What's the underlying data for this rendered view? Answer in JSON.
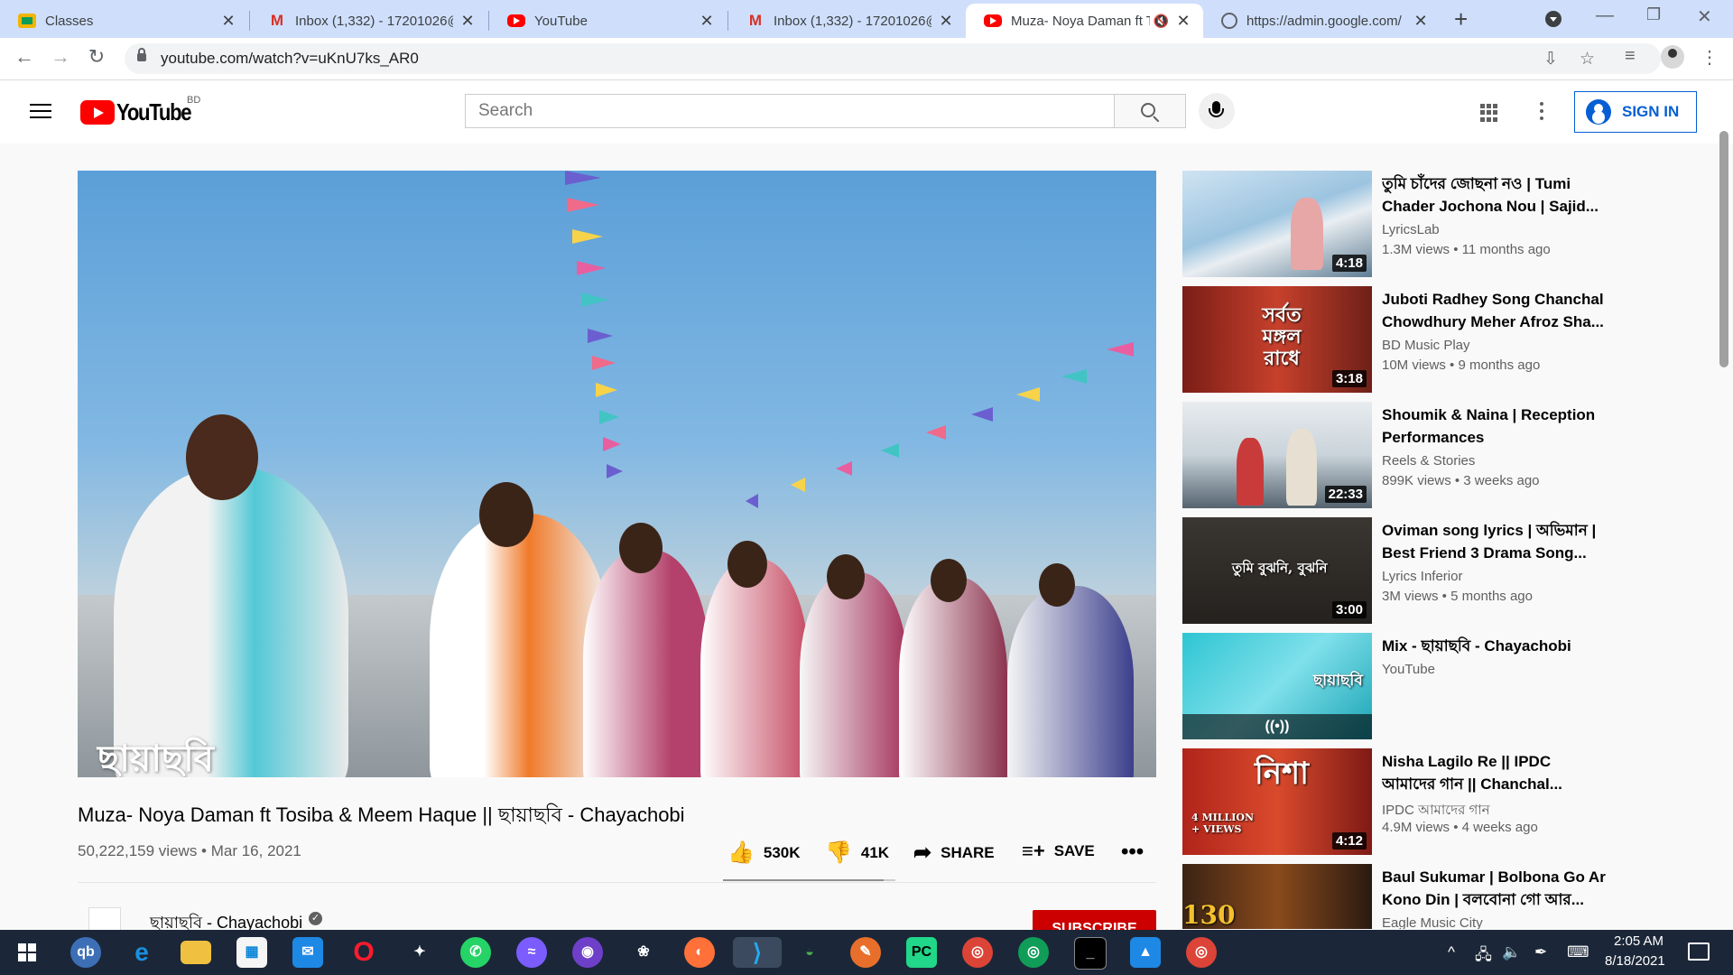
{
  "browser": {
    "tabs": [
      {
        "title": "Classes",
        "favicon": "classroom-icon"
      },
      {
        "title": "Inbox (1,332) - 17201026@",
        "favicon": "gmail-icon"
      },
      {
        "title": "YouTube",
        "favicon": "youtube-icon"
      },
      {
        "title": "Inbox (1,332) - 17201026@",
        "favicon": "gmail-icon"
      },
      {
        "title": "Muza- Noya Daman ft T",
        "favicon": "youtube-icon",
        "active": true
      },
      {
        "title": "https://admin.google.com/",
        "favicon": "globe-icon"
      }
    ],
    "url": "youtube.com/watch?v=uKnU7ks_AR0"
  },
  "youtube": {
    "logo_text": "YouTube",
    "country": "BD",
    "search_placeholder": "Search",
    "sign_in_label": "SIGN IN"
  },
  "video": {
    "watermark": "ছায়াছবি",
    "title": "Muza- Noya Daman ft Tosiba & Meem Haque || ছায়াছবি - Chayachobi",
    "views_date": "50,222,159 views • Mar 16, 2021",
    "likes": "530K",
    "dislikes": "41K",
    "share_label": "SHARE",
    "save_label": "SAVE",
    "like_ratio": 0.93,
    "channel_name": "ছায়াছবি - Chayachobi",
    "subscribe_label": "SUBSCRIBE"
  },
  "recommendations": [
    {
      "title": "তুমি চাঁদের জোছনা নও | Tumi Chader Jochona Nou | Sajid...",
      "channel": "LyricsLab",
      "meta": "1.3M views • 11 months ago",
      "duration": "4:18"
    },
    {
      "title": "Juboti Radhey Song Chanchal Chowdhury Meher Afroz Sha...",
      "channel": "BD Music Play",
      "meta": "10M views • 9 months ago",
      "duration": "3:18",
      "thumb_text": "সর্বত মঙ্গল রাধে"
    },
    {
      "title": "Shoumik & Naina | Reception Performances",
      "channel": "Reels & Stories",
      "meta": "899K views • 3 weeks ago",
      "duration": "22:33"
    },
    {
      "title": "Oviman song lyrics | অভিমান | Best Friend 3 Drama Song...",
      "channel": "Lyrics Inferior",
      "meta": "3M views • 5 months ago",
      "duration": "3:00",
      "thumb_text": "তুমি বুঝনি, বুঝনি"
    },
    {
      "title": "Mix - ছায়াছবি - Chayachobi",
      "channel": "YouTube",
      "meta": "",
      "duration": "((•))",
      "thumb_text": "ছায়াছবি"
    },
    {
      "title": "Nisha Lagilo Re || IPDC আমাদের গান || Chanchal...",
      "channel": "IPDC আমাদের গান",
      "meta": "4.9M views • 4 weeks ago",
      "duration": "4:12",
      "thumb_text": "নিশা",
      "thumb_badge": "4 MILLION + VIEWS"
    },
    {
      "title": "Baul Sukumar | Bolbona Go Ar Kono Din | বলবোনা গো আর...",
      "channel": "Eagle Music City",
      "meta": "",
      "duration": "",
      "thumb_text": "130"
    }
  ],
  "taskbar": {
    "time": "2:05 AM",
    "date": "8/18/2021"
  }
}
